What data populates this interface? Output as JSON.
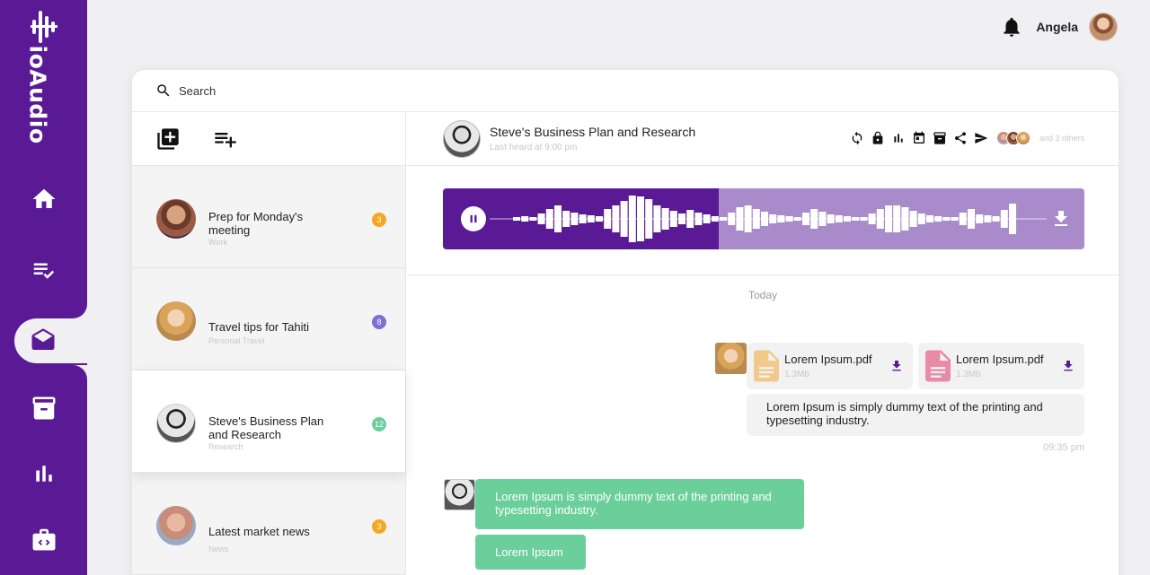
{
  "brand": {
    "name": "ioAudio"
  },
  "nav": [
    {
      "name": "home",
      "icon": "home-icon",
      "active": false
    },
    {
      "name": "playlist",
      "icon": "playlist-check-icon",
      "active": false
    },
    {
      "name": "inbox",
      "icon": "mail-open-icon",
      "active": true
    },
    {
      "name": "archive",
      "icon": "archive-icon",
      "active": false
    },
    {
      "name": "stats",
      "icon": "bar-chart-icon",
      "active": false
    },
    {
      "name": "developer",
      "icon": "briefcase-code-icon",
      "active": false
    }
  ],
  "user": {
    "name": "Angela",
    "icon": "bell-icon"
  },
  "search": {
    "placeholder": "Search",
    "icon": "search-icon"
  },
  "list_tools": {
    "add_icon": "library-add-icon",
    "playlist_add_icon": "playlist-add-icon"
  },
  "conversations": [
    {
      "title": "Prep for Monday's meeting",
      "subtitle": "Work",
      "badge": "3",
      "badge_color": "#f5a623",
      "active": false
    },
    {
      "title": "Travel tips for Tahiti",
      "subtitle": "Personal Travel",
      "badge": "8",
      "badge_color": "#7b6fd1",
      "active": false
    },
    {
      "title": "Steve's Business Plan and Research",
      "subtitle": "Research",
      "badge": "12",
      "badge_color": "#6bcf9b",
      "active": true
    },
    {
      "title": "Latest market news",
      "subtitle": "News",
      "badge": "3",
      "badge_color": "#f5a623",
      "active": false
    }
  ],
  "chat": {
    "title": "Steve's Business Plan and Research",
    "subtitle": "Last heard at 9:00 pm",
    "others": "and 3 others",
    "actions": [
      "sync-icon",
      "lock-icon",
      "equalizer-icon",
      "calendar-icon",
      "archive-icon",
      "share-icon",
      "send-icon"
    ],
    "player": {
      "progress": 0.43,
      "state": "playing"
    },
    "today_label": "Today",
    "attachments": [
      {
        "name": "Lorem Ipsum.pdf",
        "size": "1.3Mb",
        "color": "#f3c98b"
      },
      {
        "name": "Lorem Ipsum.pdf",
        "size": "1.3Mb",
        "color": "#e88aa8"
      }
    ],
    "sent_text": "Lorem Ipsum is simply dummy text of the printing and typesetting industry.",
    "sent_time": "09:35 pm",
    "received": [
      "Lorem Ipsum is simply dummy text of the printing and typesetting industry.",
      "Lorem Ipsum"
    ]
  },
  "colors": {
    "brand": "#5a1a96",
    "brand_light": "#a98bcb",
    "green": "#6bcf9b"
  }
}
